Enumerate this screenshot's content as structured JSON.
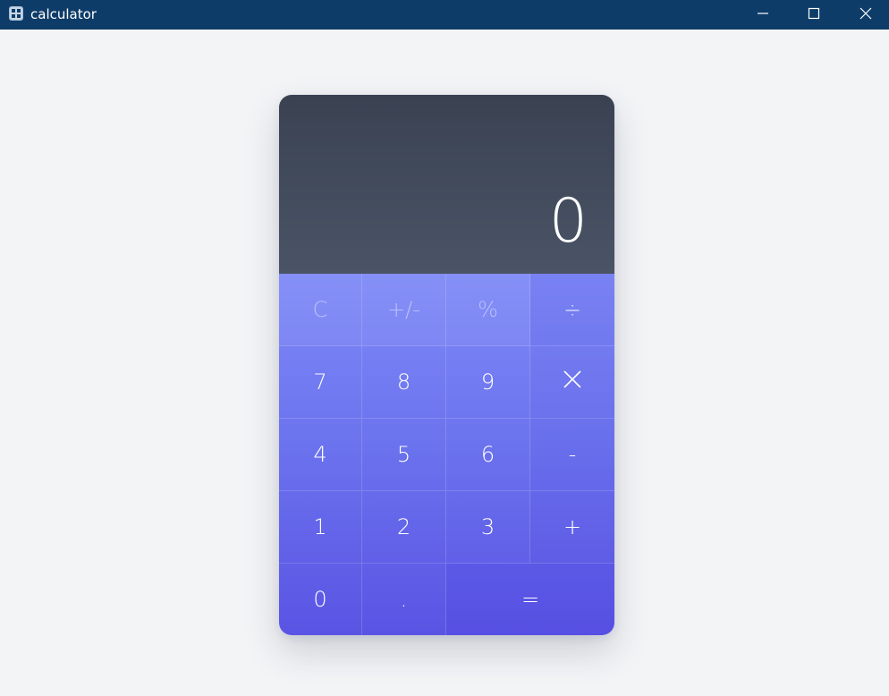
{
  "window": {
    "title": "calculator",
    "icon": "calculator-app-icon",
    "controls": {
      "minimize_icon": "minimize-icon",
      "maximize_icon": "maximize-icon",
      "close_icon": "close-icon"
    }
  },
  "display": {
    "value": "0"
  },
  "keys": {
    "clear": "C",
    "sign": "+/-",
    "percent": "%",
    "divide": "÷",
    "seven": "7",
    "eight": "8",
    "nine": "9",
    "multiply_icon": "multiply-icon",
    "four": "4",
    "five": "5",
    "six": "6",
    "subtract": "-",
    "one": "1",
    "two": "2",
    "three": "3",
    "add": "+",
    "zero": "0",
    "decimal": ".",
    "equals": "="
  },
  "colors": {
    "titlebar": "#0e3c69",
    "background": "#f3f4f6",
    "display_top": "#3a4252",
    "display_bottom": "#4a5466",
    "keypad_top": "#7e89f7",
    "keypad_bottom": "#5a54e4"
  }
}
